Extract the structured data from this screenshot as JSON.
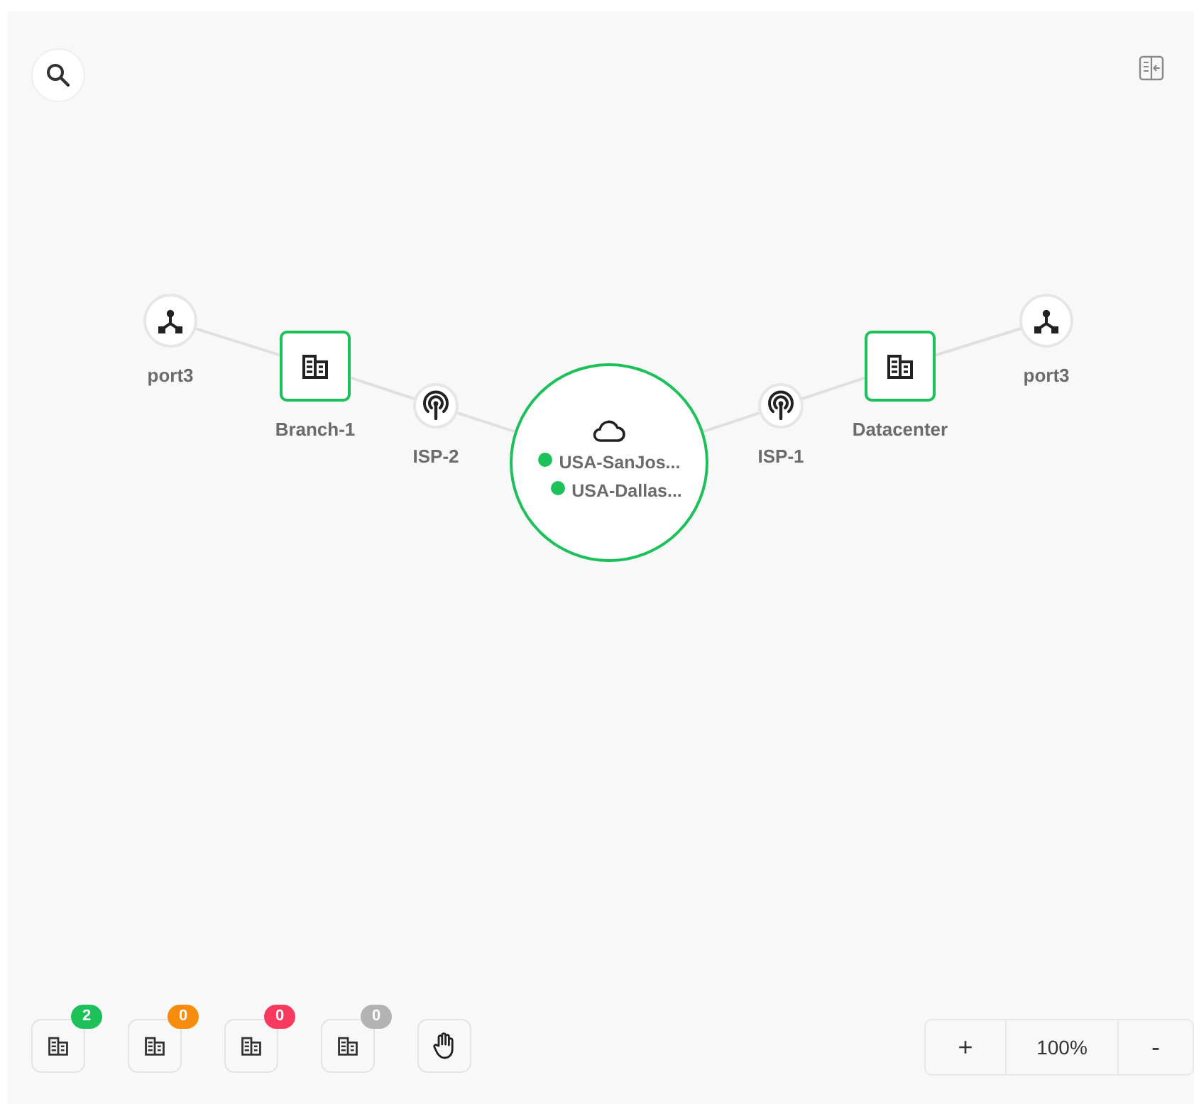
{
  "nodes": [
    {
      "kind": "port",
      "label": "port3"
    },
    {
      "kind": "site",
      "label": "Branch-1",
      "selected": true
    },
    {
      "kind": "isp",
      "label": "ISP-2"
    },
    {
      "kind": "cloud",
      "selected": true,
      "members": [
        {
          "label": "USA-SanJos...",
          "color": "#1cc15a"
        },
        {
          "label": "USA-Dallas...",
          "color": "#1cc15a"
        }
      ]
    },
    {
      "kind": "isp",
      "label": "ISP-1"
    },
    {
      "kind": "site",
      "label": "Datacenter",
      "selected": true
    },
    {
      "kind": "port",
      "label": "port3"
    }
  ],
  "filters": [
    {
      "count": "2",
      "color": "#1cc15a"
    },
    {
      "count": "0",
      "color": "#f68b0c"
    },
    {
      "count": "0",
      "color": "#f73a5e"
    },
    {
      "count": "0",
      "color": "#b3b3b3"
    }
  ],
  "zoom": {
    "in": "+",
    "level": "100%",
    "out": "-"
  }
}
